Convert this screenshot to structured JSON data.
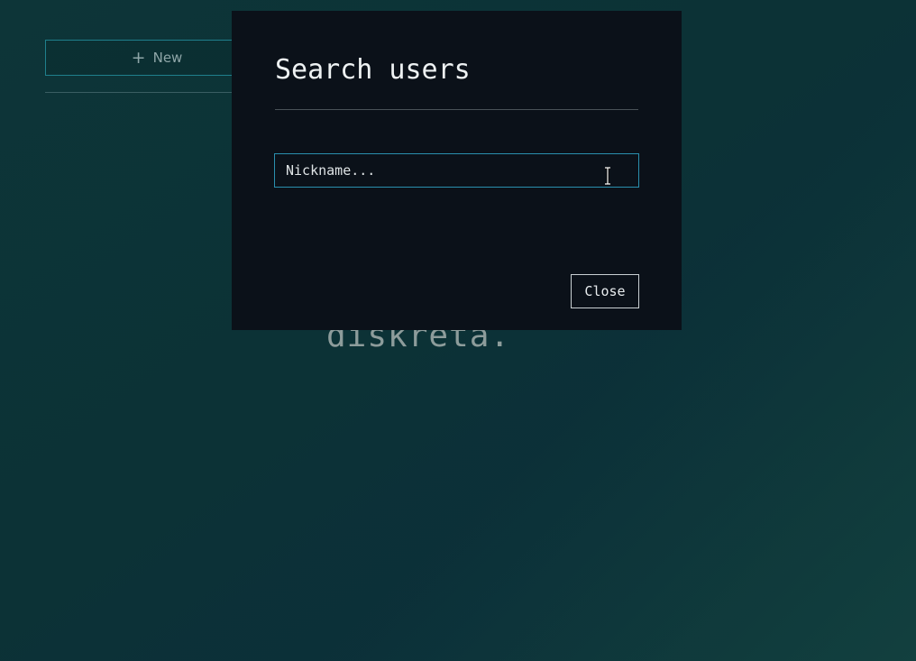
{
  "sidebar": {
    "new_button": {
      "icon": "plus-icon",
      "label": "New"
    }
  },
  "brand": {
    "text": "diskreta."
  },
  "modal": {
    "title": "Search users",
    "search": {
      "placeholder": "Nickname...",
      "value": ""
    },
    "close_label": "Close"
  },
  "colors": {
    "background_top": "#0d3538",
    "background_bottom": "#0a2c3c",
    "modal_bg": "#0b1119",
    "accent": "#2a8fae",
    "new_button_border": "#1f7f8c",
    "brand_text": "#8d9c9b"
  }
}
